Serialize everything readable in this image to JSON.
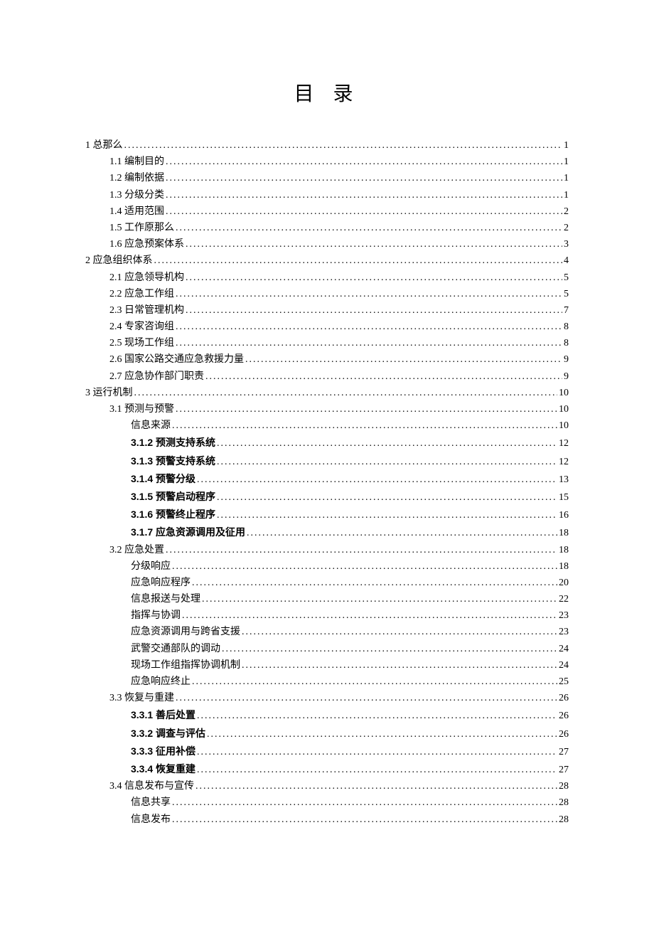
{
  "title": "目 录",
  "entries": [
    {
      "level": 1,
      "label": "1 总那么",
      "page": "1",
      "bold": false
    },
    {
      "level": 2,
      "label": "1.1 编制目的",
      "page": "1",
      "bold": false
    },
    {
      "level": 2,
      "label": "1.2 编制依据",
      "page": "1",
      "bold": false
    },
    {
      "level": 2,
      "label": "1.3 分级分类",
      "page": "1",
      "bold": false
    },
    {
      "level": 2,
      "label": "1.4 适用范围",
      "page": "2",
      "bold": false
    },
    {
      "level": 2,
      "label": "1.5 工作原那么",
      "page": "2",
      "bold": false
    },
    {
      "level": 2,
      "label": "1.6 应急预案体系",
      "page": "3",
      "bold": false
    },
    {
      "level": 1,
      "label": "2   应急组织体系",
      "page": "4",
      "bold": false
    },
    {
      "level": 2,
      "label": "2.1 应急领导机构",
      "page": "5",
      "bold": false
    },
    {
      "level": 2,
      "label": "2.2 应急工作组",
      "page": "5",
      "bold": false
    },
    {
      "level": 2,
      "label": "2.3 日常管理机构",
      "page": "7",
      "bold": false
    },
    {
      "level": 2,
      "label": "2.4 专家咨询组",
      "page": "8",
      "bold": false
    },
    {
      "level": 2,
      "label": "2.5 现场工作组",
      "page": "8",
      "bold": false
    },
    {
      "level": 2,
      "label": "2.6 国家公路交通应急救援力量",
      "page": "9",
      "bold": false
    },
    {
      "level": 2,
      "label": "2.7 应急协作部门职责",
      "page": "9",
      "bold": false
    },
    {
      "level": 1,
      "label": "3 运行机制",
      "page": "10",
      "bold": false
    },
    {
      "level": 2,
      "label": "3.1 预测与预警",
      "page": "10",
      "bold": false
    },
    {
      "level": 3,
      "label": "信息来源",
      "page": "10",
      "bold": false
    },
    {
      "level": 3,
      "label": "3.1.2 预测支持系统",
      "page": "12",
      "bold": true
    },
    {
      "level": 3,
      "label": "3.1.3 预警支持系统",
      "page": "12",
      "bold": true
    },
    {
      "level": 3,
      "label": "3.1.4 预警分级",
      "page": "13",
      "bold": true
    },
    {
      "level": 3,
      "label": "3.1.5 预警启动程序",
      "page": "15",
      "bold": true
    },
    {
      "level": 3,
      "label": "3.1.6 预警终止程序",
      "page": "16",
      "bold": true
    },
    {
      "level": 3,
      "label": "3.1.7 应急资源调用及征用",
      "page": "18",
      "bold": true
    },
    {
      "level": 2,
      "label": "3.2 应急处置",
      "page": "18",
      "bold": false
    },
    {
      "level": 3,
      "label": "分级响应",
      "page": "18",
      "bold": false
    },
    {
      "level": 3,
      "label": "应急响应程序",
      "page": "20",
      "bold": false
    },
    {
      "level": 3,
      "label": "信息报送与处理",
      "page": "22",
      "bold": false
    },
    {
      "level": 3,
      "label": "指挥与协调",
      "page": "23",
      "bold": false
    },
    {
      "level": 3,
      "label": "应急资源调用与跨省支援",
      "page": "23",
      "bold": false
    },
    {
      "level": 3,
      "label": "武警交通部队的调动",
      "page": "24",
      "bold": false
    },
    {
      "level": 3,
      "label": "现场工作组指挥协调机制",
      "page": "24",
      "bold": false
    },
    {
      "level": 3,
      "label": "应急响应终止",
      "page": "25",
      "bold": false
    },
    {
      "level": 2,
      "label": "3.3 恢复与重建",
      "page": "26",
      "bold": false
    },
    {
      "level": 3,
      "label": "3.3.1 善后处置",
      "page": "26",
      "bold": true
    },
    {
      "level": 3,
      "label": "3.3.2 调查与评估",
      "page": "26",
      "bold": true
    },
    {
      "level": 3,
      "label": "3.3.3 征用补偿",
      "page": "27",
      "bold": true
    },
    {
      "level": 3,
      "label": "3.3.4 恢复重建",
      "page": "27",
      "bold": true
    },
    {
      "level": 2,
      "label": "3.4 信息发布与宣传",
      "page": "28",
      "bold": false
    },
    {
      "level": 3,
      "label": "信息共享",
      "page": "28",
      "bold": false
    },
    {
      "level": 3,
      "label": "信息发布",
      "page": "28",
      "bold": false
    }
  ]
}
